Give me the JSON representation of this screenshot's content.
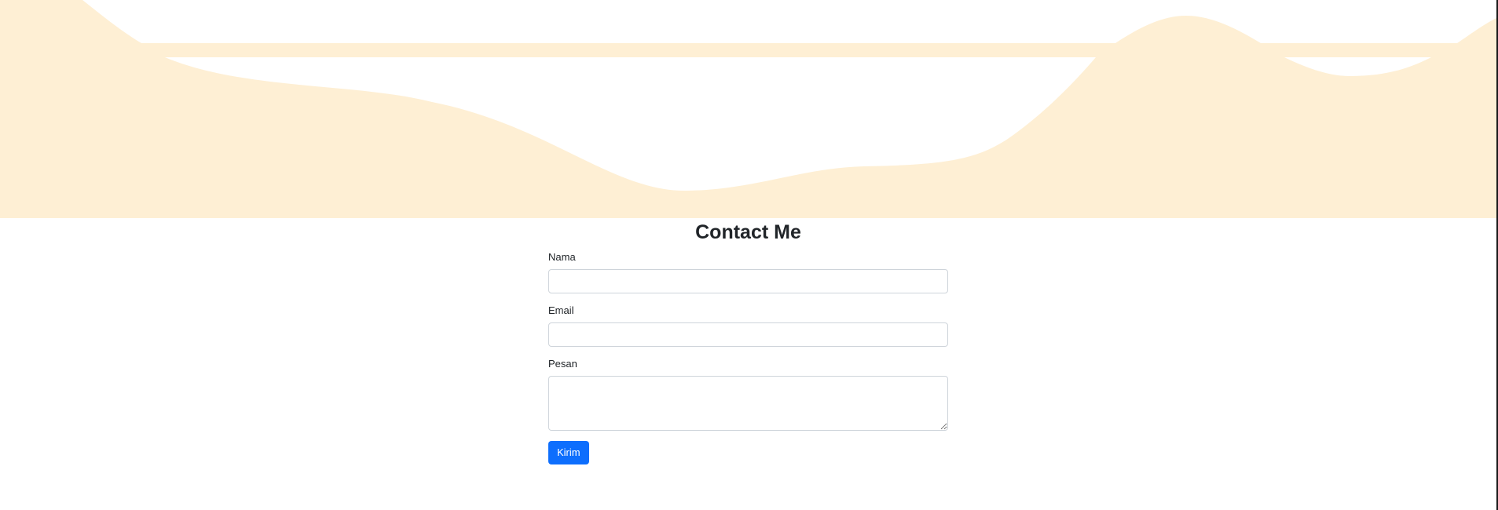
{
  "colors": {
    "wave": "#feefd4",
    "page_background": "#ffffff",
    "primary_button": "#0d6efd",
    "input_border": "#ced4da",
    "text": "#212529"
  },
  "contact": {
    "title": "Contact Me",
    "fields": [
      {
        "label": "Nama",
        "value": "",
        "placeholder": ""
      },
      {
        "label": "Email",
        "value": "",
        "placeholder": ""
      },
      {
        "label": "Pesan",
        "value": "",
        "placeholder": ""
      }
    ],
    "submit_label": "Kirim"
  }
}
